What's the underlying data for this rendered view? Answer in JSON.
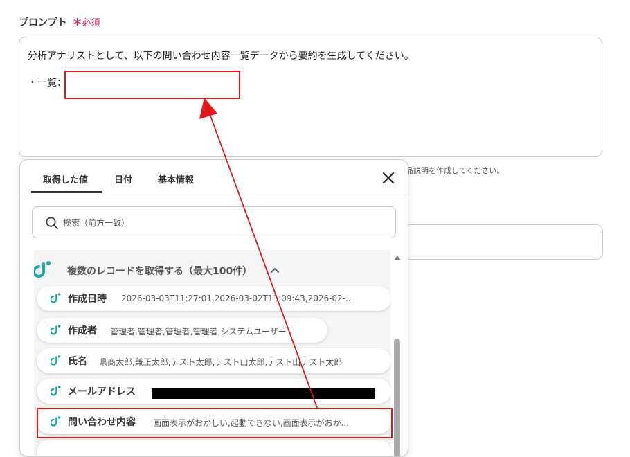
{
  "field": {
    "label": "プロンプト",
    "required_mark": "＊",
    "required_text": "必須"
  },
  "prompt": {
    "line1": "分析アナリストとして、以下の問い合わせ内容一覧データから要約を生成してください。",
    "line2": "・一覧："
  },
  "hint": "品説明を作成してください。",
  "popup": {
    "tabs": [
      {
        "label": "取得した値",
        "active": true
      },
      {
        "label": "日付",
        "active": false
      },
      {
        "label": "基本情報",
        "active": false
      }
    ],
    "search": {
      "placeholder": "検索（前方一致）",
      "value": ""
    },
    "group": {
      "title": "複数のレコードを取得する（最大100件）"
    },
    "items": [
      {
        "label": "作成日時",
        "value": "2026-03-03T11:27:01,2026-03-02T11:09:43,2026-02-..."
      },
      {
        "label": "作成者",
        "value": "管理者,管理者,管理者,管理者,システムユーザー"
      },
      {
        "label": "氏名",
        "value": "県商太郎,兼正太郎,テスト太郎,テスト山太郎,テスト山テスト太郎"
      },
      {
        "label": "メールアドレス",
        "value": ""
      },
      {
        "label": "問い合わせ内容",
        "value": "画面表示がおかしい,起動できない,画面表示がおか..."
      }
    ]
  },
  "colors": {
    "required": "#e0245e",
    "annotation": "#e0171c",
    "brand_teal": "#1aa8a8"
  },
  "icons": {
    "close": "close-icon",
    "search": "search-icon",
    "chevron": "chevron-up-icon",
    "app": "app-logo-icon"
  }
}
